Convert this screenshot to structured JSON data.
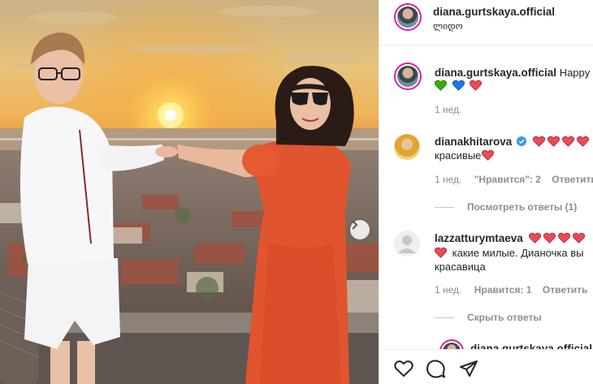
{
  "post": {
    "author": "diana.gurtskaya.official",
    "location": "ლიდო"
  },
  "caption": {
    "username": "diana.gurtskaya.official",
    "text": "Happy",
    "emoji_hearts": [
      "green-heart",
      "blue-heart",
      "red-heart"
    ],
    "time": "1 нед."
  },
  "comments": [
    {
      "username": "dianakhitarova",
      "verified": true,
      "hearts": 4,
      "text": "красивые",
      "time": "1 нед.",
      "likes": "\"Нравится\": 2",
      "reply": "Ответить",
      "thread": "Посмотреть ответы (1)"
    },
    {
      "username": "lazzatturymtaeva",
      "hearts": 5,
      "text_line1": "какие милые. Дианочка вы",
      "text_line2": "красавица",
      "time": "1 нед.",
      "likes": "Нравится: 1",
      "reply": "Ответить",
      "thread": "Скрыть ответы"
    }
  ],
  "partial_reply": {
    "username": "diana.gurtskaya.official"
  },
  "colors": {
    "heart_red": "#ed4956",
    "heart_green": "#38b000",
    "heart_blue": "#1877f2",
    "verified_blue": "#3897f0",
    "meta_gray": "#8e8e8e"
  }
}
